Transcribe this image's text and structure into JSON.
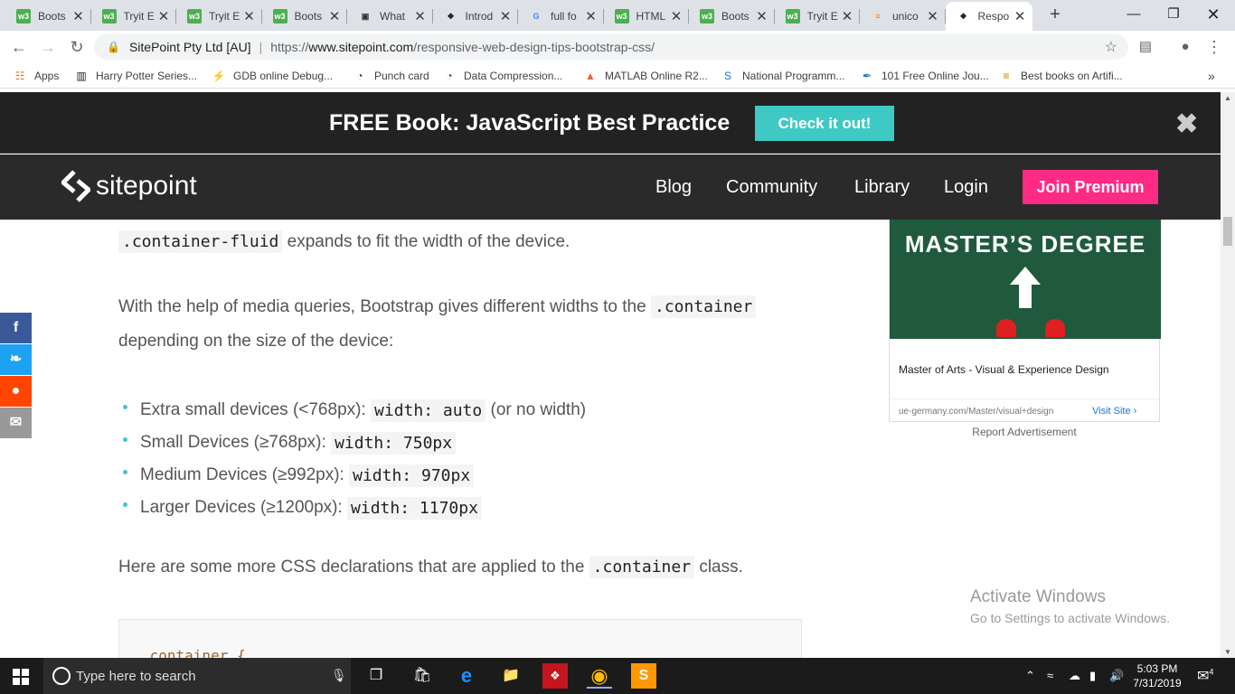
{
  "browser": {
    "tabs": [
      {
        "title": "Boots",
        "icon": "w3schools-icon"
      },
      {
        "title": "Tryit E",
        "icon": "w3schools-icon"
      },
      {
        "title": "Tryit E",
        "icon": "w3schools-icon"
      },
      {
        "title": "Boots",
        "icon": "w3schools-icon"
      },
      {
        "title": "What",
        "icon": "save-icon"
      },
      {
        "title": "Introd",
        "icon": "sitepoint-icon"
      },
      {
        "title": "full fo",
        "icon": "google-icon"
      },
      {
        "title": "HTML",
        "icon": "w3schools-icon"
      },
      {
        "title": "Boots",
        "icon": "w3schools-icon"
      },
      {
        "title": "Tryit E",
        "icon": "w3schools-icon"
      },
      {
        "title": "unico",
        "icon": "stackoverflow-icon"
      },
      {
        "title": "Respo",
        "icon": "sitepoint-icon",
        "active": true
      }
    ],
    "favicon_w3_label": "w3",
    "omnibox": {
      "org": "SitePoint Pty Ltd [AU]",
      "separator": "|",
      "scheme": "https://",
      "host": "www.sitepoint.com",
      "path": "/responsive-web-design-tips-bootstrap-css/"
    },
    "bookmarks": [
      {
        "label": "Apps",
        "icon": "apps-grid-icon"
      },
      {
        "label": "Harry Potter Series...",
        "icon": "book-icon"
      },
      {
        "label": "GDB online Debug...",
        "icon": "gdb-icon"
      },
      {
        "label": "Punch card",
        "icon": "globe-icon"
      },
      {
        "label": "Data Compression...",
        "icon": "globe-icon"
      },
      {
        "label": "MATLAB Online R2...",
        "icon": "matlab-icon"
      },
      {
        "label": "National Programm...",
        "icon": "swayam-icon"
      },
      {
        "label": "101 Free Online Jou...",
        "icon": "journal-icon"
      },
      {
        "label": "Best books on Artifi...",
        "icon": "books-icon"
      }
    ]
  },
  "promo": {
    "text": "FREE Book: JavaScript Best Practice",
    "button": "Check it out!"
  },
  "sitenav": {
    "logo": "sitepoint",
    "links": [
      "Blog",
      "Community",
      "Library",
      "Login"
    ],
    "premium": "Join Premium"
  },
  "article": {
    "p1_code": ".container-fluid",
    "p1_text": " expands to fit the width of the device.",
    "p2_text": "With the help of media queries, Bootstrap gives different widths to the ",
    "p2_code": ".container",
    "p2_cont": "depending on the size of the device:",
    "bullets": [
      {
        "text": "Extra small devices (<768px): ",
        "code": "width: auto",
        "after": " (or no width)"
      },
      {
        "text": "Small Devices (≥768px): ",
        "code": "width: 750px",
        "after": ""
      },
      {
        "text": "Medium Devices (≥992px): ",
        "code": "width: 970px",
        "after": ""
      },
      {
        "text": "Larger Devices (≥1200px): ",
        "code": "width: 1170px",
        "after": ""
      }
    ],
    "p3_text": "Here are some more CSS declarations that are applied to the ",
    "p3_code": ".container",
    "p3_after": " class.",
    "code_line": ".container {"
  },
  "social": [
    {
      "name": "facebook",
      "glyph": "f",
      "color": "#3b5998"
    },
    {
      "name": "twitter",
      "glyph": "❧",
      "color": "#1da1f2"
    },
    {
      "name": "reddit",
      "glyph": "●",
      "color": "#ff4500"
    },
    {
      "name": "email",
      "glyph": "✉",
      "color": "#999999"
    }
  ],
  "ad": {
    "headline": "MASTER’S DEGREE",
    "title": "Master of Arts - Visual & Experience Design",
    "url": "ue-germany.com/Master/visual+design",
    "visit": "Visit Site",
    "report": "Report Advertisement"
  },
  "watermark": {
    "line1": "Activate Windows",
    "line2": "Go to Settings to activate Windows."
  },
  "taskbar": {
    "search_placeholder": "Type here to search",
    "time": "5:03 PM",
    "date": "7/31/2019",
    "notification_count": "4"
  },
  "colors": {
    "promo_button": "#3fc9c5",
    "premium_button": "#ff2a83",
    "nav_bg": "#2a2a2a"
  }
}
